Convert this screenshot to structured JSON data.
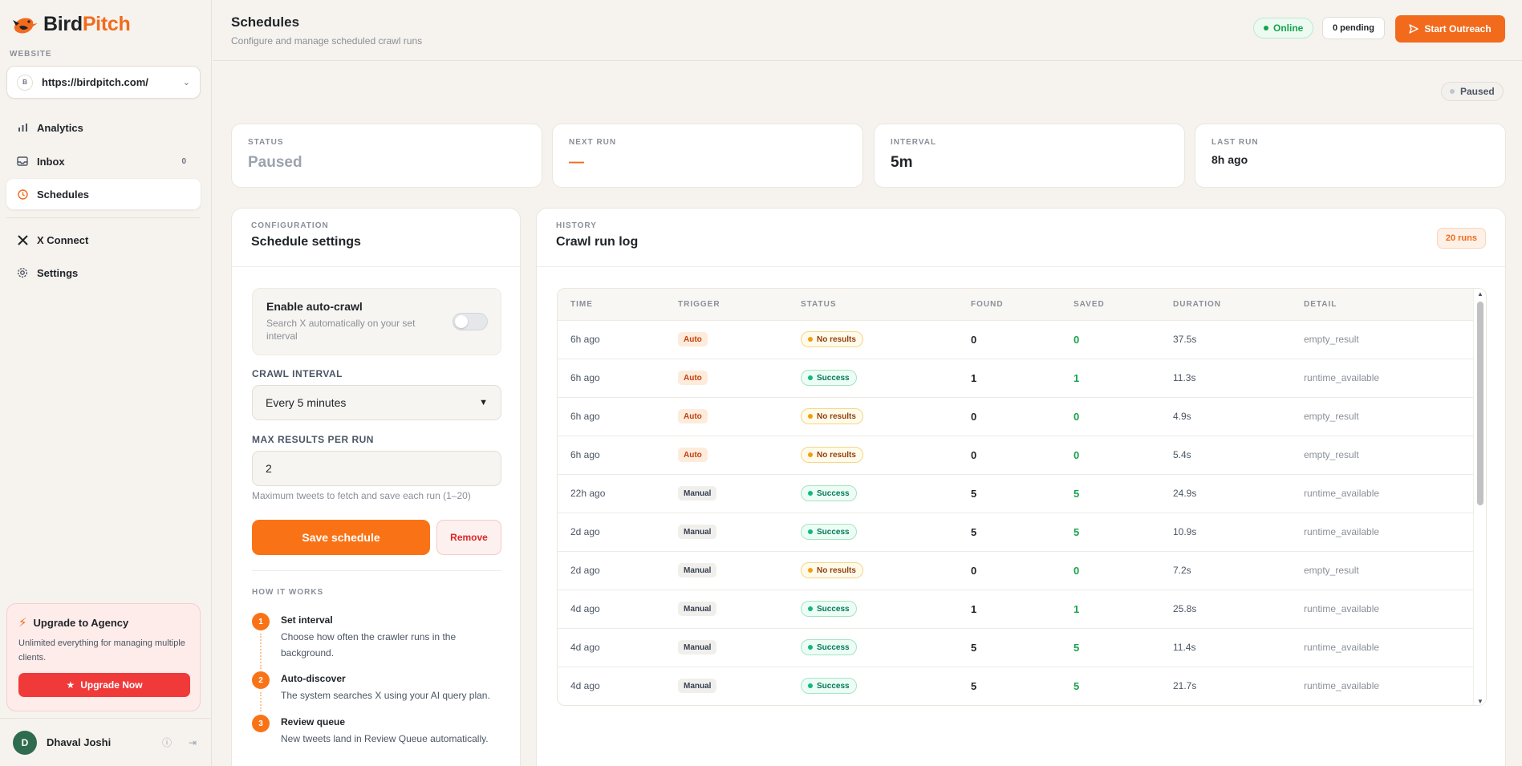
{
  "brand": {
    "name_part1": "Bird",
    "name_part2": "Pitch",
    "accent": "#f26b1d"
  },
  "sidebar": {
    "website_label": "WEBSITE",
    "site_initial": "B",
    "site_url": "https://birdpitch.com/",
    "nav": [
      {
        "label": "Analytics",
        "icon": "bar-chart-icon"
      },
      {
        "label": "Inbox",
        "icon": "inbox-icon",
        "count": "0"
      },
      {
        "label": "Schedules",
        "icon": "clock-icon",
        "active": true
      },
      {
        "label": "X Connect",
        "icon": "x-logo-icon"
      },
      {
        "label": "Settings",
        "icon": "gear-icon"
      }
    ],
    "upgrade": {
      "title": "Upgrade to Agency",
      "desc": "Unlimited everything for managing multiple clients.",
      "button": "Upgrade Now"
    },
    "user": {
      "initial": "D",
      "name": "Dhaval Joshi"
    }
  },
  "header": {
    "title": "Schedules",
    "subtitle": "Configure and manage scheduled crawl runs",
    "online": "Online",
    "pending": "0 pending",
    "start": "Start Outreach"
  },
  "status_pill": "Paused",
  "stats": [
    {
      "label": "STATUS",
      "value": "Paused",
      "color": "#9ca3af"
    },
    {
      "label": "NEXT RUN",
      "value": "—",
      "color": "#f26b1d"
    },
    {
      "label": "INTERVAL",
      "value": "5m",
      "color": "#1f2328"
    },
    {
      "label": "LAST RUN",
      "value": "8h ago",
      "color": "#1f2328"
    }
  ],
  "config": {
    "eyebrow": "CONFIGURATION",
    "title": "Schedule settings",
    "auto_title": "Enable auto-crawl",
    "auto_desc": "Search X automatically on your set interval",
    "auto_enabled": false,
    "interval_label": "CRAWL INTERVAL",
    "interval_value": "Every 5 minutes",
    "max_label": "MAX RESULTS PER RUN",
    "max_value": "2",
    "max_help": "Maximum tweets to fetch and save each run (1–20)",
    "save": "Save schedule",
    "remove": "Remove",
    "hiw_label": "HOW IT WORKS",
    "steps": [
      {
        "n": "1",
        "title": "Set interval",
        "desc": "Choose how often the crawler runs in the background."
      },
      {
        "n": "2",
        "title": "Auto-discover",
        "desc": "The system searches X using your AI query plan."
      },
      {
        "n": "3",
        "title": "Review queue",
        "desc": "New tweets land in Review Queue automatically."
      }
    ]
  },
  "history": {
    "eyebrow": "HISTORY",
    "title": "Crawl run log",
    "runs": "20 runs",
    "columns": [
      "TIME",
      "TRIGGER",
      "STATUS",
      "FOUND",
      "SAVED",
      "DURATION",
      "DETAIL"
    ],
    "rows": [
      {
        "time": "6h ago",
        "trigger": "Auto",
        "status": "No results",
        "found": "0",
        "saved": "0",
        "duration": "37.5s",
        "detail": "empty_result"
      },
      {
        "time": "6h ago",
        "trigger": "Auto",
        "status": "Success",
        "found": "1",
        "saved": "1",
        "duration": "11.3s",
        "detail": "runtime_available"
      },
      {
        "time": "6h ago",
        "trigger": "Auto",
        "status": "No results",
        "found": "0",
        "saved": "0",
        "duration": "4.9s",
        "detail": "empty_result"
      },
      {
        "time": "6h ago",
        "trigger": "Auto",
        "status": "No results",
        "found": "0",
        "saved": "0",
        "duration": "5.4s",
        "detail": "empty_result"
      },
      {
        "time": "22h ago",
        "trigger": "Manual",
        "status": "Success",
        "found": "5",
        "saved": "5",
        "duration": "24.9s",
        "detail": "runtime_available"
      },
      {
        "time": "2d ago",
        "trigger": "Manual",
        "status": "Success",
        "found": "5",
        "saved": "5",
        "duration": "10.9s",
        "detail": "runtime_available"
      },
      {
        "time": "2d ago",
        "trigger": "Manual",
        "status": "No results",
        "found": "0",
        "saved": "0",
        "duration": "7.2s",
        "detail": "empty_result"
      },
      {
        "time": "4d ago",
        "trigger": "Manual",
        "status": "Success",
        "found": "1",
        "saved": "1",
        "duration": "25.8s",
        "detail": "runtime_available"
      },
      {
        "time": "4d ago",
        "trigger": "Manual",
        "status": "Success",
        "found": "5",
        "saved": "5",
        "duration": "11.4s",
        "detail": "runtime_available"
      },
      {
        "time": "4d ago",
        "trigger": "Manual",
        "status": "Success",
        "found": "5",
        "saved": "5",
        "duration": "21.7s",
        "detail": "runtime_available"
      }
    ]
  }
}
